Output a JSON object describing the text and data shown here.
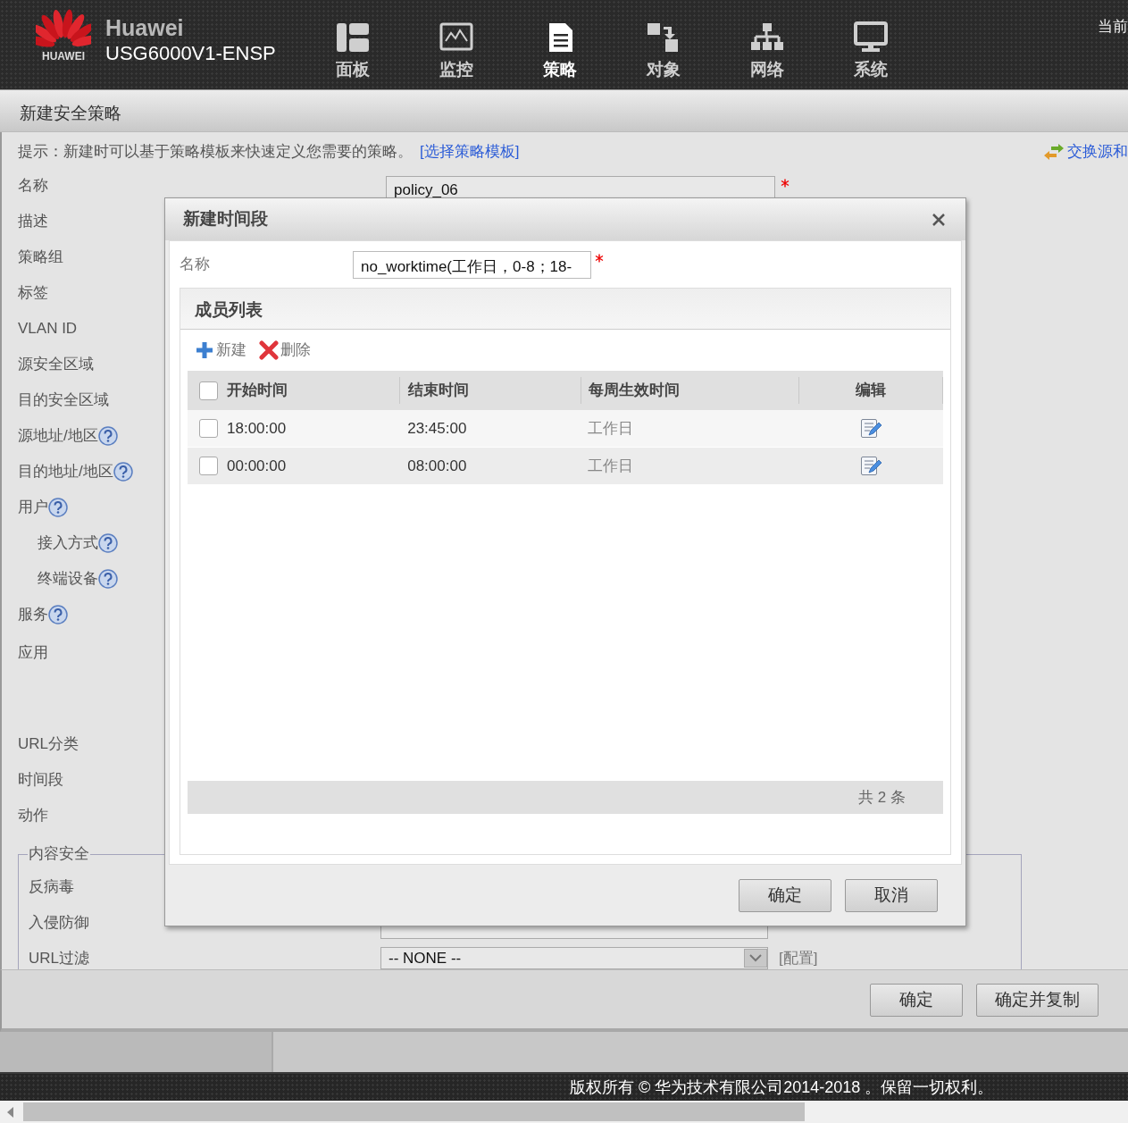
{
  "header": {
    "logo_text": "HUAWEI",
    "brand": "Huawei",
    "model": "USG6000V1-ENSP",
    "corner_text": "当前",
    "nav": [
      {
        "label": "面板",
        "selected": false
      },
      {
        "label": "监控",
        "selected": false
      },
      {
        "label": "策略",
        "selected": true
      },
      {
        "label": "对象",
        "selected": false
      },
      {
        "label": "网络",
        "selected": false
      },
      {
        "label": "系统",
        "selected": false
      }
    ]
  },
  "page": {
    "title": "新建安全策略",
    "hint": "提示：新建时可以基于策略模板来快速定义您需要的策略。",
    "template_link": "[选择策略模板]",
    "swap_link": "交换源和",
    "name_field": {
      "value": "policy_06"
    },
    "labels": [
      {
        "label": "名称",
        "help": false
      },
      {
        "label": "描述",
        "help": false
      },
      {
        "label": "策略组",
        "help": false
      },
      {
        "label": "标签",
        "help": false
      },
      {
        "label": "VLAN ID",
        "help": false
      },
      {
        "label": "源安全区域",
        "help": false
      },
      {
        "label": "目的安全区域",
        "help": false
      },
      {
        "label": "源地址/地区",
        "help": true
      },
      {
        "label": "目的地址/地区",
        "help": true
      },
      {
        "label": "用户",
        "help": true,
        "children": [
          {
            "label": "接入方式",
            "help": true
          },
          {
            "label": "终端设备",
            "help": true
          }
        ]
      },
      {
        "label": "服务",
        "help": true
      },
      {
        "label": "应用",
        "help": false
      },
      {
        "label": "URL分类",
        "help": false
      },
      {
        "label": "时间段",
        "help": false
      },
      {
        "label": "动作",
        "help": false
      }
    ],
    "content_security": {
      "legend": "内容安全",
      "items": [
        {
          "label": "反病毒"
        },
        {
          "label": "入侵防御",
          "kind": "select"
        },
        {
          "label": "URL过滤",
          "kind": "select",
          "select": "-- NONE --",
          "config_link": "[配置]"
        }
      ]
    },
    "buttons": [
      "确定",
      "确定并复制"
    ]
  },
  "dialog": {
    "title": "新建时间段",
    "name_label": "名称",
    "name_value": "no_worktime(工作日，0-8；18-",
    "list_title": "成员列表",
    "toolbar": [
      {
        "label": "新建",
        "kind": "add"
      },
      {
        "label": "删除",
        "kind": "delete"
      }
    ],
    "header_checked": false,
    "columns": [
      "开始时间",
      "结束时间",
      "每周生效时间",
      "编辑"
    ],
    "rows": [
      {
        "start": "18:00:00",
        "end": "23:45:00",
        "weekly": "工作日",
        "checked": false
      },
      {
        "start": "00:00:00",
        "end": "08:00:00",
        "weekly": "工作日",
        "checked": false
      }
    ],
    "total": "共 2 条",
    "buttons": [
      "确定",
      "取消"
    ]
  },
  "footer": {
    "copyright": "版权所有 © 华为技术有限公司2014-2018 。保留一切权利。"
  }
}
